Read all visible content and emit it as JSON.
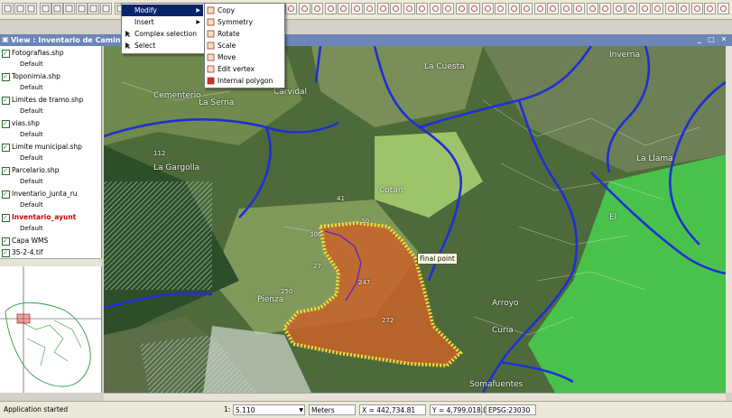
{
  "toolbar": {
    "icons": [
      "open-icon",
      "new-icon",
      "save-icon",
      "zoom-in-icon",
      "zoom-out-icon",
      "zoom-full-icon",
      "pan-icon",
      "layers-icon",
      "info-icon",
      "select-icon",
      "measure-icon",
      "draw-point-icon",
      "draw-line-icon",
      "draw-polygon-icon",
      "edit-vertex-icon",
      "table-icon",
      "print-icon"
    ]
  },
  "view": {
    "title": "View : Inventario de Caminos"
  },
  "layers": [
    {
      "name": "Fotografias.shp",
      "symbol": "Default"
    },
    {
      "name": "Toponimia.shp",
      "symbol": "Default"
    },
    {
      "name": "Limites de tramo.shp",
      "symbol": "Default"
    },
    {
      "name": "vias.shp",
      "symbol": "Default"
    },
    {
      "name": "Limite municipal.shp",
      "symbol": "Default"
    },
    {
      "name": "Parcelario.shp",
      "symbol": "Default"
    },
    {
      "name": "Inventario_junta_ru",
      "symbol": "Default"
    },
    {
      "name": "Inventario_ayunt",
      "symbol": "Default"
    },
    {
      "name": "Capa WMS",
      "symbol": ""
    },
    {
      "name": "35-2-4.tif",
      "symbol": ""
    }
  ],
  "context_menu": {
    "items": [
      {
        "label": "Modify",
        "submenu": true,
        "selected": true
      },
      {
        "label": "Insert",
        "submenu": true
      },
      {
        "label": "Complex selection"
      },
      {
        "label": "Select"
      }
    ],
    "submenu": [
      {
        "label": "Copy",
        "icon": "copy-icon"
      },
      {
        "label": "Symmetry",
        "icon": "symmetry-icon"
      },
      {
        "label": "Rotate",
        "icon": "rotate-icon"
      },
      {
        "label": "Scale",
        "icon": "scale-icon"
      },
      {
        "label": "Move",
        "icon": "move-icon"
      },
      {
        "label": "Edit vertex",
        "icon": "edit-vertex-icon"
      },
      {
        "label": "Internal polygon",
        "icon": "internal-polygon-icon"
      }
    ]
  },
  "map": {
    "tooltip": "Final point",
    "place_labels": [
      "La Cuesta",
      "Cementerio",
      "Carvidal",
      "La Serna",
      "La Gargolla",
      "Cotan",
      "Pienza",
      "Arroyo",
      "Curia",
      "Somafuentes",
      "El",
      "La Llama",
      "Inverna"
    ],
    "parcel_numbers": [
      "272",
      "250",
      "247",
      "306",
      "41",
      "112",
      "30",
      "27"
    ],
    "colors": {
      "road": "#1f2fd6",
      "polygon": "#c9622a",
      "vertex": "#f2e23a",
      "sea": "#3bbd44"
    }
  },
  "status": {
    "message": "Application started",
    "scale_label": "1:",
    "scale_value": "5.110",
    "units": "Meters",
    "x": "X = 442,734.81",
    "y": "Y = 4,799,018.02",
    "epsg": "EPSG:23030"
  }
}
